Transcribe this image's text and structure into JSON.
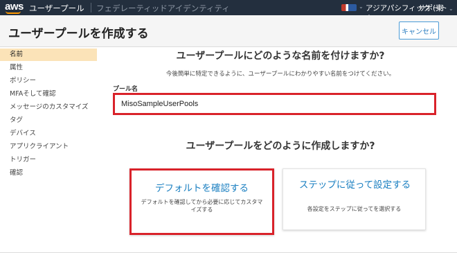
{
  "topbar": {
    "logo": "aws",
    "service": "ユーザープール",
    "subservice": "フェデレーティッドアイデンティティ",
    "region": "アジアパシフィック (東京)",
    "support": "サポート"
  },
  "header": {
    "title": "ユーザープールを作成する",
    "cancel_label": "キャンセル"
  },
  "sidebar": {
    "items": [
      {
        "label": "名前"
      },
      {
        "label": "属性"
      },
      {
        "label": "ポリシー"
      },
      {
        "label": "MFAそして確認"
      },
      {
        "label": "メッセージのカスタマイズ"
      },
      {
        "label": "タグ"
      },
      {
        "label": "デバイス"
      },
      {
        "label": "アプリクライアント"
      },
      {
        "label": "トリガー"
      },
      {
        "label": "確認"
      }
    ]
  },
  "main": {
    "heading_name": "ユーザープールにどのような名前を付けますか?",
    "subtext": "今後簡単に特定できるように、ユーザープールにわかりやすい名前をつけてください。",
    "pool_name_label": "プール名",
    "pool_name_value": "MisoSampleUserPools",
    "heading_how": "ユーザープールをどのように作成しますか?",
    "card_default_title": "デフォルトを確認する",
    "card_default_desc": "デフォルトを確認してから必要に応じてカスタマイズする",
    "card_step_title": "ステップに従って設定する",
    "card_step_desc": "各設定をステップに従ってを選択する"
  },
  "colors": {
    "topbar_bg": "#232f3e",
    "accent_link": "#1a7fc1",
    "highlight_red": "#d9222a",
    "active_sidebar": "#fbe3b8"
  }
}
